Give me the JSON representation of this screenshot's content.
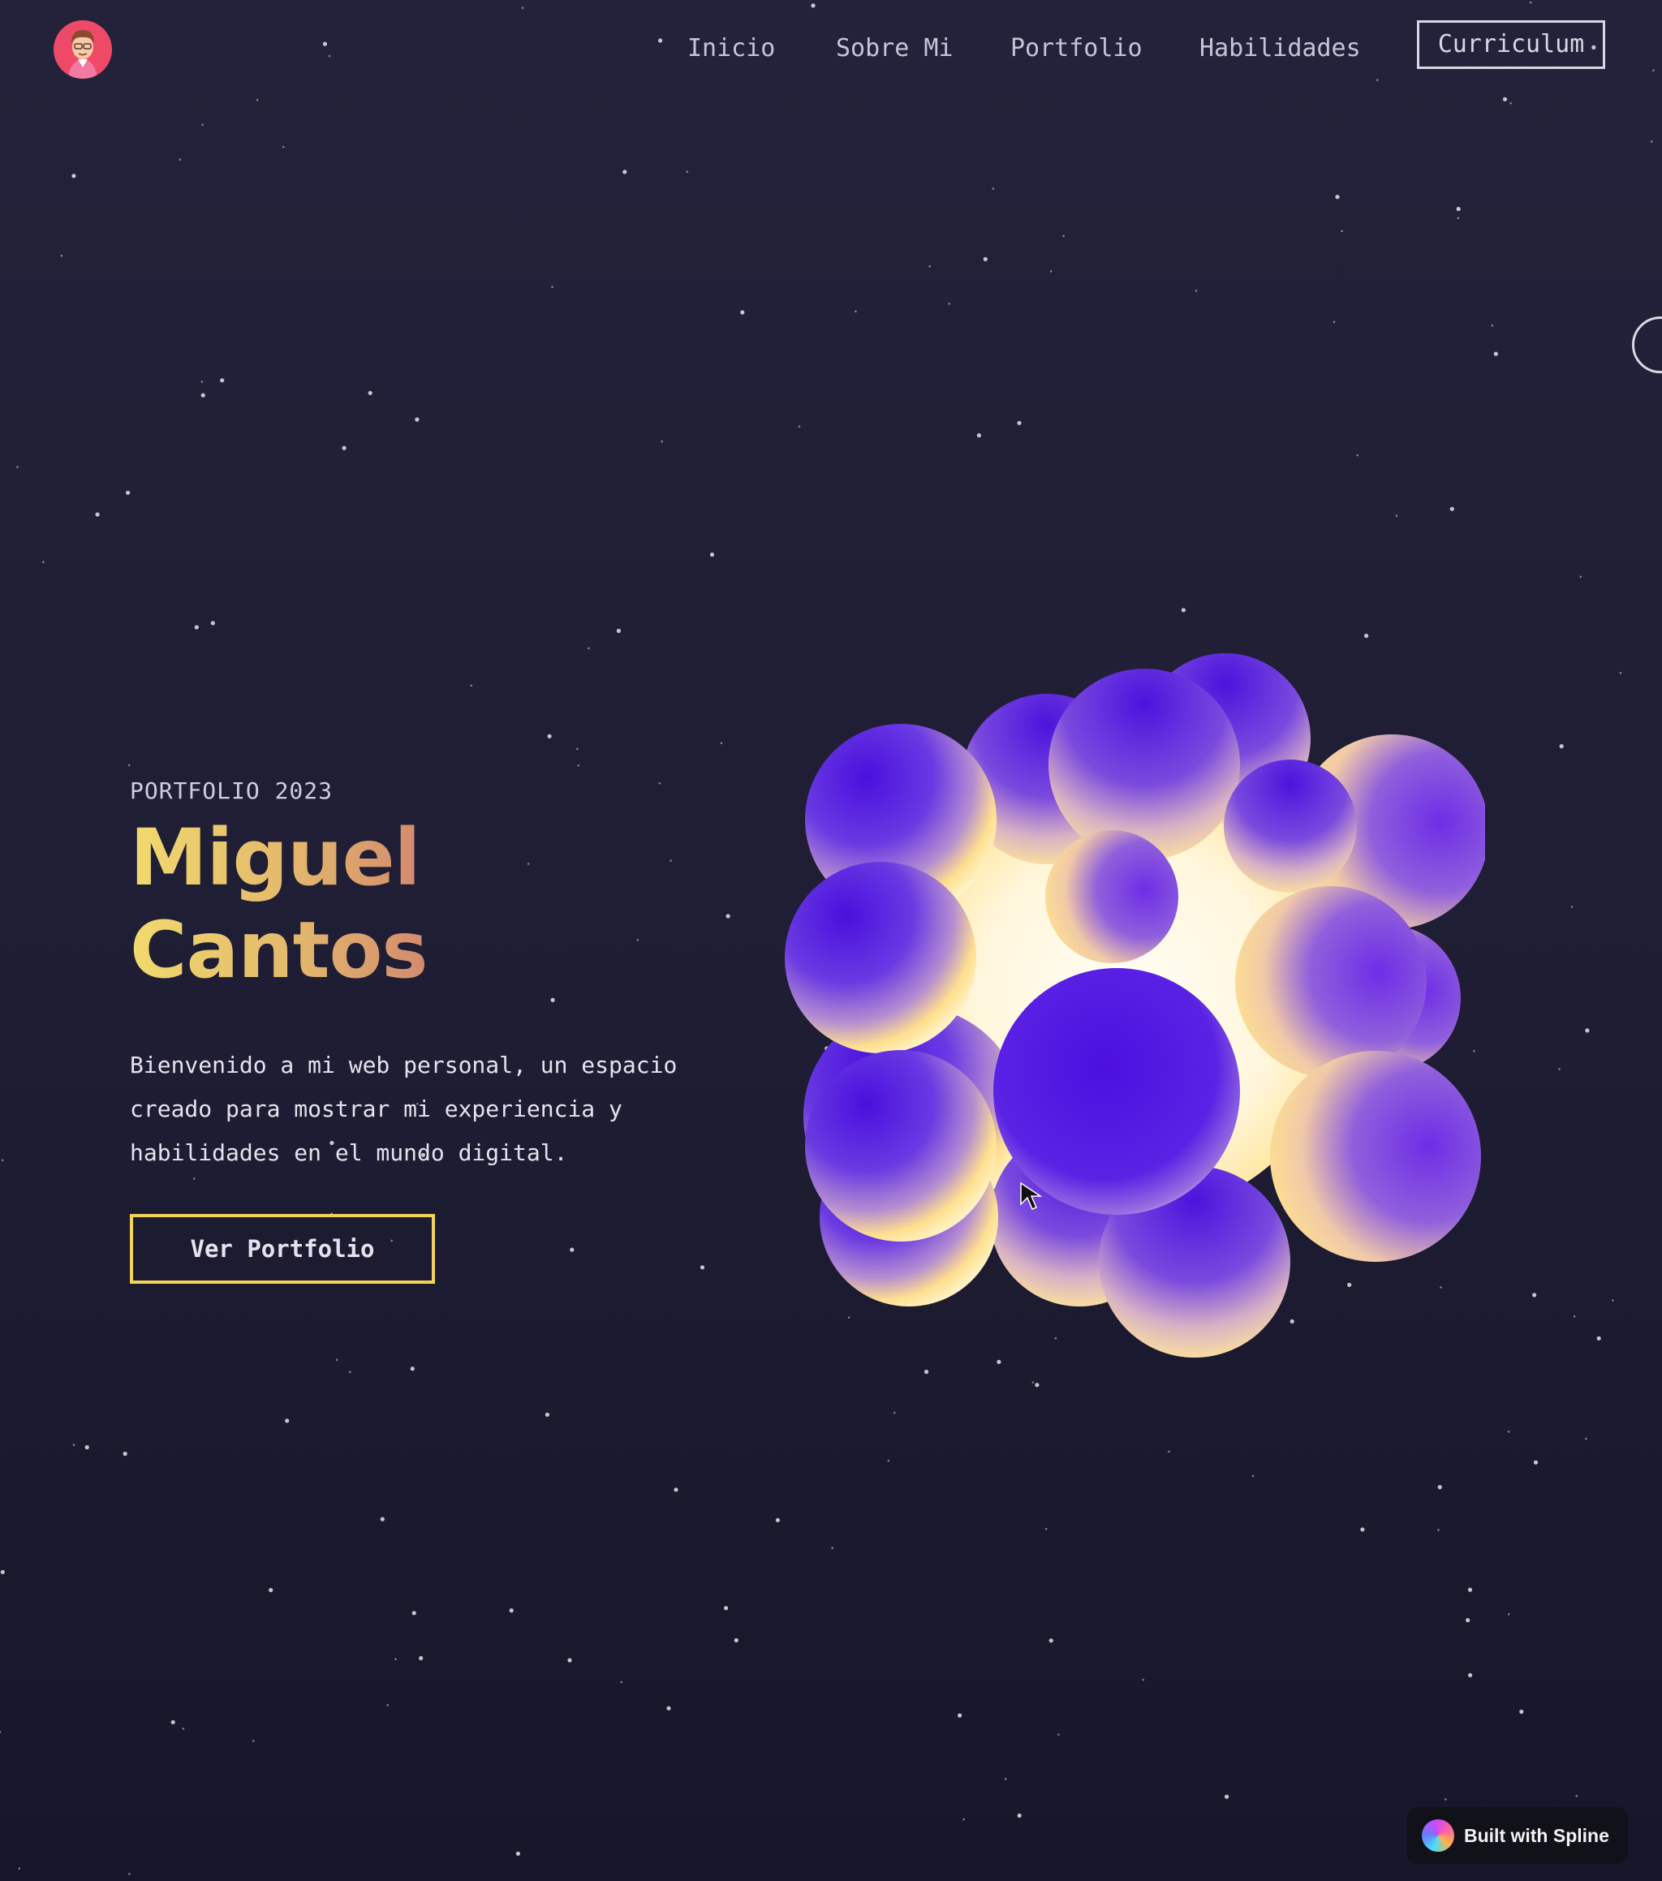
{
  "header": {
    "logo_icon": "avatar-logo-icon",
    "nav": [
      {
        "label": "Inicio"
      },
      {
        "label": "Sobre Mi"
      },
      {
        "label": "Portfolio"
      },
      {
        "label": "Habilidades"
      }
    ],
    "cv_label": "Curriculum"
  },
  "hero": {
    "eyebrow": "PORTFOLIO 2023",
    "title_line1": "Miguel",
    "title_line2": "Cantos",
    "intro_lines": [
      "Bienvenido a mi web personal, un espacio",
      "creado para mostrar mi experiencia y",
      "habilidades en el mundo digital."
    ],
    "button_label": "Ver Portfolio"
  },
  "badge": {
    "label": "Built with Spline",
    "icon": "spline-logo-icon"
  },
  "colors": {
    "background": "#1f1f35",
    "accent_yellow": "#f2d35a",
    "title_gradient_start": "#f1da6e",
    "title_gradient_end": "#d38a6e",
    "sphere_violet": "#4a14e0",
    "sphere_glow": "#ffe08a",
    "avatar_red": "#ee4a67"
  }
}
